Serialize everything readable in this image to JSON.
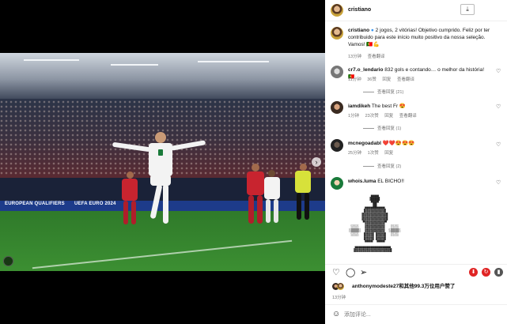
{
  "post": {
    "author": "cristiano",
    "caption": "2 jogos, 2 vitórias! Objetivo cumprido. Feliz por ter contribuido para este início muito positivo da nossa seleção. Vamos! 🇵🇹💪",
    "time": "13分钟",
    "translate": "查看翻译",
    "likes_line": "anthonymodeste27和其他99.3万位用户赞了",
    "posted_ago": "13分钟",
    "ad_left": "EUROPEAN QUALIFIERS",
    "ad_mid": "UEFA EURO 2024"
  },
  "comments": [
    {
      "user": "cr7.o_lendario",
      "text": "832 gols e contando… o melhor da história! 🇵🇹",
      "time": "11分钟",
      "likes": "36赞",
      "reply": "回复",
      "translate": "查看翻译",
      "view_replies": "查看回复 (21)"
    },
    {
      "user": "iamdikeh",
      "text": "The best Fr 😍",
      "time": "1分钟",
      "likes": "23次赞",
      "reply": "回复",
      "translate": "查看翻译",
      "view_replies": "查看回复 (1)"
    },
    {
      "user": "mcnegoadabl",
      "text": "❤️❤️😍😍😍",
      "time": "25分钟",
      "likes": "1次赞",
      "reply": "回复",
      "view_replies": "查看回复 (2)"
    },
    {
      "user": "whois.luma",
      "text": "EL BICHO!!"
    }
  ],
  "input": {
    "placeholder": "添加评论..."
  },
  "icons": {
    "more": "more-icon",
    "heart": "heart-icon",
    "comment": "comment-icon",
    "share": "share-icon",
    "save": "save-icon",
    "emoji": "emoji-icon"
  }
}
